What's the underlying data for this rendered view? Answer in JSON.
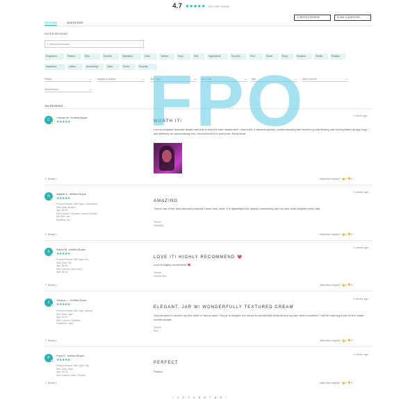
{
  "summary": {
    "rating": "4.7",
    "stars": "★★★★★",
    "count_text": "from 266 reviews"
  },
  "actions": {
    "write_review": "✎ WRITE A REVIEW",
    "ask_question": "✉ ASK A QUESTION"
  },
  "tabs": {
    "reviews": "REVIEWS",
    "questions": "QUESTIONS"
  },
  "filters": {
    "heading": "FILTER REVIEWS",
    "search_placeholder": "Search Reviews",
    "chips": [
      "Fragrance",
      "Texture",
      "Skin",
      "Smooth",
      "Hydration",
      "Glow",
      "Texture",
      "Face",
      "Soft",
      "Ingredients",
      "Dry skin",
      "Feel",
      "Scent",
      "Body",
      "Moisture",
      "Gentle",
      "Routine",
      "Hydration",
      "Lather",
      "Nourishing",
      "Glow",
      "Pores",
      "Favorite"
    ],
    "selects": [
      "Rating",
      "Images & Videos",
      "Skin Type",
      "Skin Tone",
      "Age",
      "Skin Concern"
    ],
    "sort": "Most Recent"
  },
  "reviews_count": "266 REVIEWS",
  "reviews": [
    {
      "initial": "C",
      "name": "Chante W. Verified Buyer",
      "meta": [],
      "date": "1 week ago",
      "title": "WORTH IT!",
      "body": "I am a complete skincare fanatic and this is truly the best moisturizer I have tried. It absorbs quickly, smells amazing and leaves my skin feeling soft and hydrated all day long. I will definitely be repurchasing this, I recommend it to everyone. Read More",
      "extra": [],
      "helpful": "Was this helpful?",
      "up": "0",
      "down": "0"
    },
    {
      "initial": "N",
      "name": "Natalie K. Verified Buyer",
      "meta": [
        "Product Review: Skin Type: Combination",
        "Skin Tone: Medium",
        "Age: 25-34",
        "Skin Concern: Dryness, Uneven Texture",
        "Dry Skin: Yes",
        "Sensitive: No"
      ],
      "date": "2 weeks ago",
      "title": "AMAZING",
      "body": "This is one of the best skincare products I have ever used. It is lightweight but deeply moisturizing and my skin looks brighter every day.",
      "extra": [
        "Texture:",
        "Hydrating"
      ],
      "helpful": "Was this helpful?",
      "up": "0",
      "down": "0"
    },
    {
      "initial": "S",
      "name": "Sarah M. Verified Buyer",
      "meta": [
        "Product Review: Skin Type: Dry",
        "Skin Tone: Fair",
        "Age: 35-44",
        "Skin Concern: Fine Lines",
        "Age: 35-44"
      ],
      "date": "2 weeks ago",
      "title": "LOVE IT! HIGHLY RECOMMEND 💗",
      "body": "Love it! Highly recommend 💗",
      "extra": [
        "Texture:",
        "Smooth Skin"
      ],
      "helpful": "Was this helpful?",
      "up": "0",
      "down": "0"
    },
    {
      "initial": "J",
      "name": "Jessica L. Verified Buyer",
      "meta": [
        "Product Review: Skin Type: Normal",
        "Skin Tone: Light",
        "Age: 25-34",
        "Skin Concern: Dullness",
        "Fragrance: Light"
      ],
      "date": "3 weeks ago",
      "title": "ELEGANT, JAR W/ WONDERFULLY TEXTURED CREAM",
      "body": "Very pleased to receive my first order of this product. The jar is elegant, the cream is wonderfully textured and my skin feels nourished. I will be ordering more for the colder months ahead.",
      "extra": [
        "Texture:",
        "Rich"
      ],
      "helpful": "Was this helpful?",
      "up": "0",
      "down": "0"
    },
    {
      "initial": "P",
      "name": "Priya R. Verified Buyer",
      "meta": [
        "Product Review: Skin Type: Oily",
        "Skin Tone: Deep",
        "Age: 18-24",
        "Skin Concern: Acne, Texture"
      ],
      "date": "1 month ago",
      "title": "PERFECT",
      "body": "Perfect",
      "extra": [],
      "helpful": "Was this helpful?",
      "up": "0",
      "down": "0"
    }
  ],
  "share": "Share",
  "watermark": "FPO",
  "pagination": "‹ 1 2 3 4 5 6 7 8 9 ›",
  "colors": {
    "accent": "#2bb0b4",
    "chip_bg": "#e2f3f3",
    "watermark": "#5cc8e4"
  }
}
